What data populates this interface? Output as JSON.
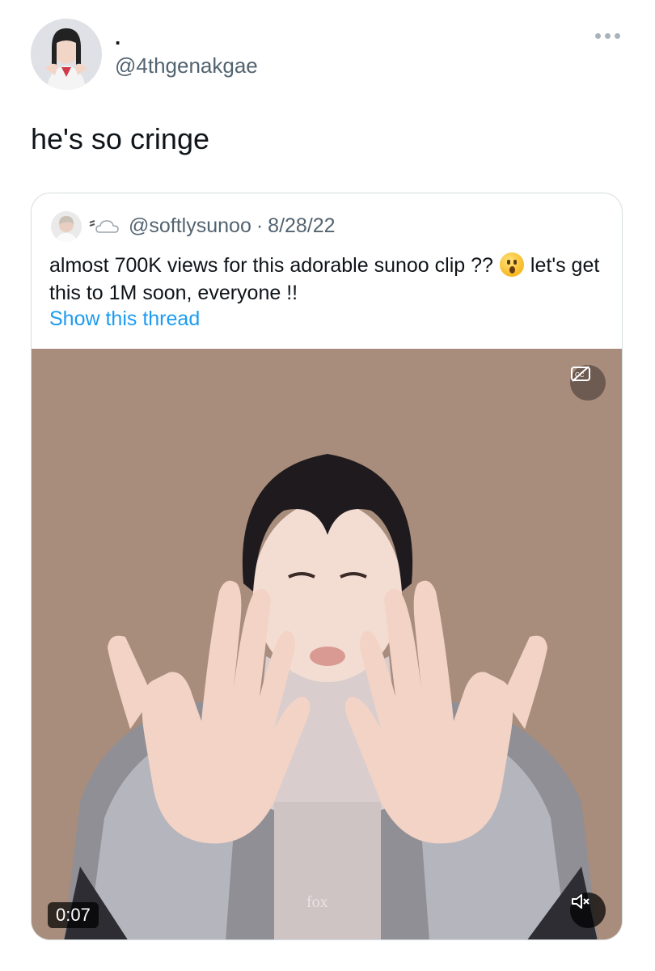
{
  "tweet": {
    "display_name": ".",
    "handle": "@4thgenakgae",
    "text": "he's so cringe",
    "more_icon": "ellipsis-icon"
  },
  "quoted_tweet": {
    "handle": "@softlysunoo",
    "separator": "·",
    "date": "8/28/22",
    "text_before_emoji": "almost 700K views for this adorable sunoo clip ??",
    "emoji": "astonished-face-emoji",
    "text_after_emoji": "let's get this to 1M soon, everyone !!",
    "show_thread": "Show this thread",
    "video": {
      "timestamp": "0:07",
      "watermark": "fox",
      "cc_icon": "captions-off-icon",
      "mute_icon": "speaker-muted-icon"
    }
  },
  "colors": {
    "link": "#1d9bf0",
    "secondary_text": "#536471",
    "border": "#d7dde1",
    "video_background": "#a88c7c"
  }
}
